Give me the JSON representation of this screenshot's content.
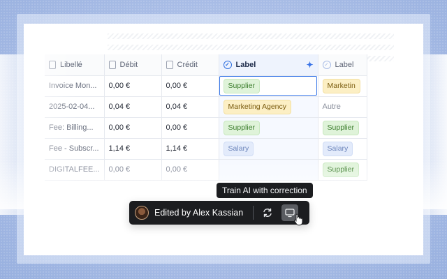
{
  "table": {
    "headers": {
      "libelle": "Libellé",
      "debit": "Débit",
      "credit": "Crédit",
      "label": "Label",
      "label2": "Label"
    },
    "rows": [
      {
        "libelle": "Invoice Mon...",
        "debit": "0,00 €",
        "credit": "0,00 €",
        "label": "Supplier",
        "label_color": "green",
        "label2": "Marketin"
      },
      {
        "libelle": "2025-02-04...",
        "debit": "0,04 €",
        "credit": "0,04 €",
        "label": "Marketing Agency",
        "label_color": "yellow",
        "label2": "Autre"
      },
      {
        "libelle": "Fee: Billing...",
        "debit": "0,00 €",
        "credit": "0,00 €",
        "label": "Supplier",
        "label_color": "green",
        "label2": "Supplier"
      },
      {
        "libelle": "Fee - Subscr...",
        "debit": "1,14 €",
        "credit": "1,14 €",
        "label": "Salary",
        "label_color": "blue",
        "label2": "Salary"
      },
      {
        "libelle": "DIGITALFEE...",
        "debit": "0,00 €",
        "credit": "0,00 €",
        "label": "",
        "label_color": "",
        "label2": "Supplier"
      }
    ]
  },
  "tooltip": {
    "text": "Train AI with correction"
  },
  "toolbar": {
    "edited_by": "Edited by Alex Kassian"
  },
  "icons": {
    "libelle_header": "document-icon",
    "debit_header": "document-icon",
    "credit_header": "document-icon",
    "label_header": "check-circle-icon",
    "ai_sparkle": "sparkle-icon",
    "refresh": "refresh-icon",
    "train": "monitor-check-icon"
  },
  "colors": {
    "accent": "#3a78e8",
    "toolbar_bg": "#1c1d20",
    "chip_green": "#dff3d9",
    "chip_yellow": "#fcefc4",
    "chip_blue": "#e3ebfb"
  }
}
